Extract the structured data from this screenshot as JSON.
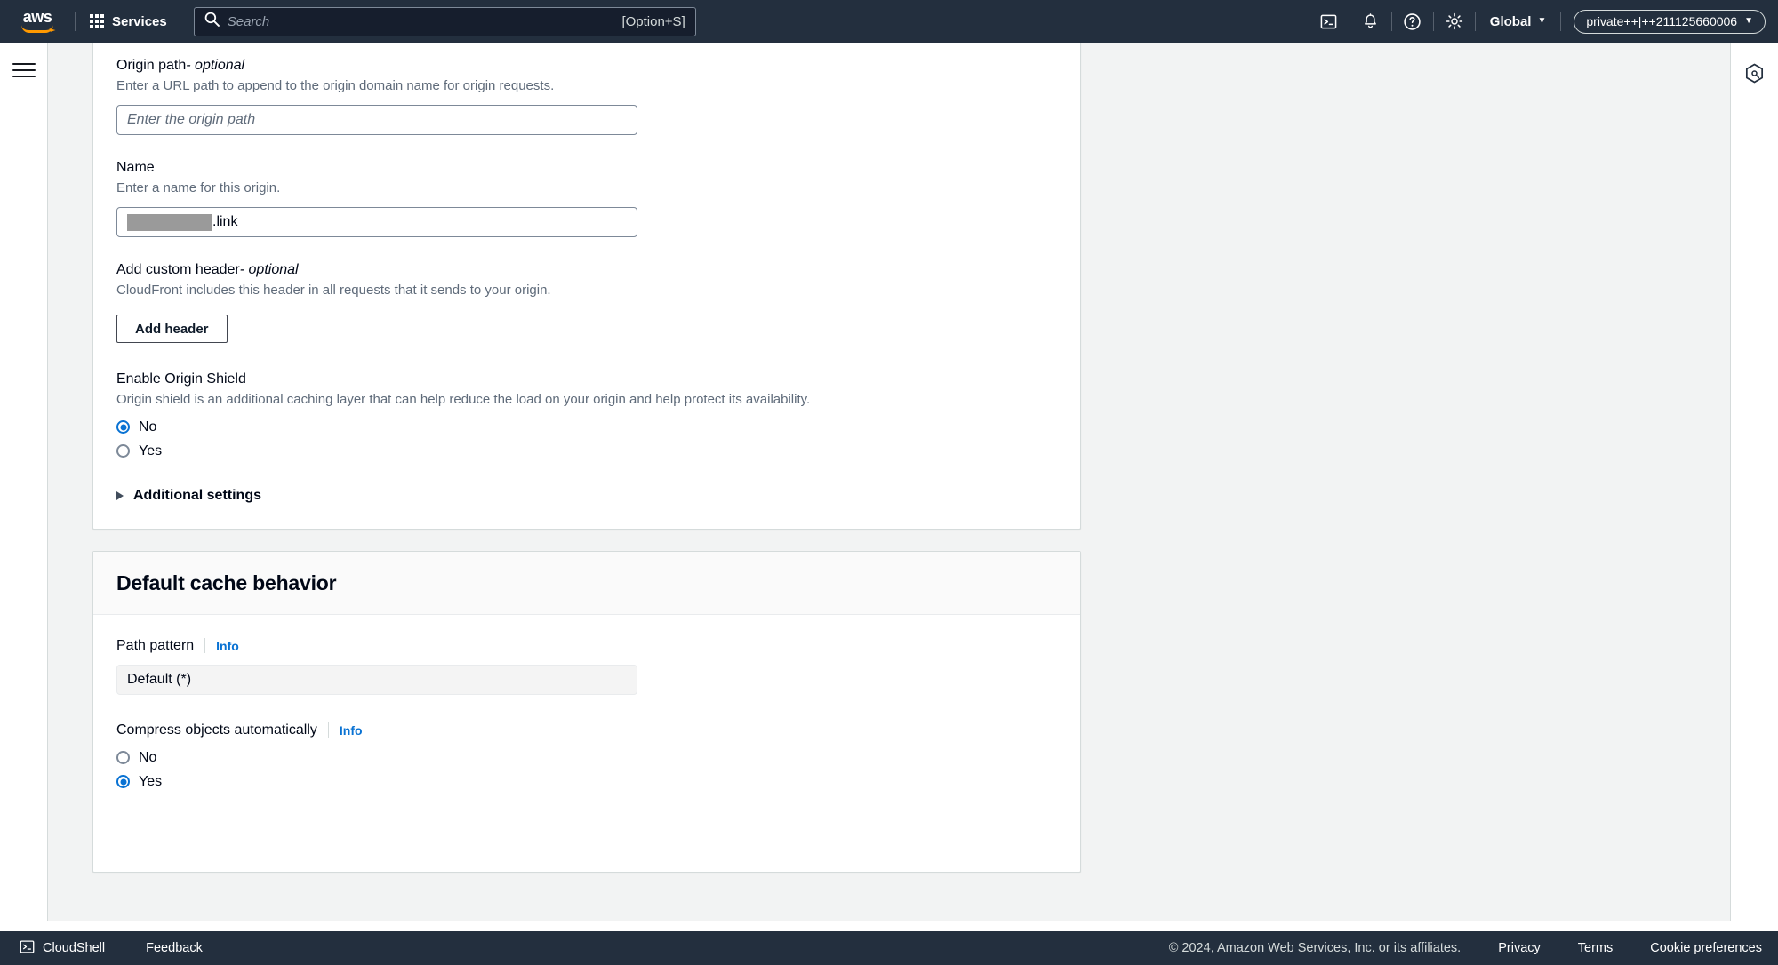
{
  "top_nav": {
    "logo_text": "aws",
    "logo_icon": "aws-logo-icon",
    "services_label": "Services",
    "services_icon": "waffle-grid-icon",
    "search": {
      "icon": "search-icon",
      "placeholder": "Search",
      "value": "",
      "shortcut": "[Option+S]"
    },
    "icons": [
      {
        "name": "cloudshell-icon",
        "title": "CloudShell"
      },
      {
        "name": "notifications-bell-icon",
        "title": "Notifications"
      },
      {
        "name": "help-question-icon",
        "title": "Help"
      },
      {
        "name": "settings-gear-icon",
        "title": "Settings"
      }
    ],
    "region_label": "Global",
    "region_caret": "▼",
    "account_label": "private++|++211125660006",
    "account_caret": "▼"
  },
  "left_rail": {
    "menu_icon": "hamburger-menu-icon"
  },
  "right_rail": {
    "panel_icon": "cloudfront-hexagon-icon"
  },
  "origin_card": {
    "origin_path": {
      "label": "Origin path",
      "optional_suffix": " - optional",
      "description": "Enter a URL path to append to the origin domain name for origin requests.",
      "placeholder": "Enter the origin path",
      "value": ""
    },
    "name": {
      "label": "Name",
      "description": "Enter a name for this origin.",
      "value_redacted_prefix": "[redacted]",
      "value_suffix": ".link"
    },
    "custom_header": {
      "label": "Add custom header",
      "optional_suffix": " - optional",
      "description": "CloudFront includes this header in all requests that it sends to your origin.",
      "button_label": "Add header"
    },
    "origin_shield": {
      "label": "Enable Origin Shield",
      "description": "Origin shield is an additional caching layer that can help reduce the load on your origin and help protect its availability.",
      "options": [
        {
          "label": "No",
          "selected": true
        },
        {
          "label": "Yes",
          "selected": false
        }
      ]
    },
    "additional_settings": {
      "label": "Additional settings",
      "expanded": false,
      "icon": "triangle-right-icon"
    }
  },
  "cache_card": {
    "title": "Default cache behavior",
    "path_pattern": {
      "label": "Path pattern",
      "info_label": "Info",
      "value": "Default (*)",
      "disabled": true
    },
    "compress": {
      "label": "Compress objects automatically",
      "info_label": "Info",
      "options": [
        {
          "label": "No",
          "selected": false
        },
        {
          "label": "Yes",
          "selected": true
        }
      ]
    }
  },
  "footer": {
    "cloudshell_label": "CloudShell",
    "cloudshell_icon": "cloudshell-icon",
    "feedback_label": "Feedback",
    "copyright": "© 2024, Amazon Web Services, Inc. or its affiliates.",
    "links": [
      {
        "label": "Privacy"
      },
      {
        "label": "Terms"
      },
      {
        "label": "Cookie preferences"
      }
    ]
  },
  "colors": {
    "nav_bg": "#232f3e",
    "accent_blue": "#0972d3",
    "page_bg": "#f2f3f3",
    "card_border": "#d5dbdb",
    "text_primary": "#000716",
    "text_secondary": "#5f6b7a",
    "orange": "#ff9900"
  }
}
